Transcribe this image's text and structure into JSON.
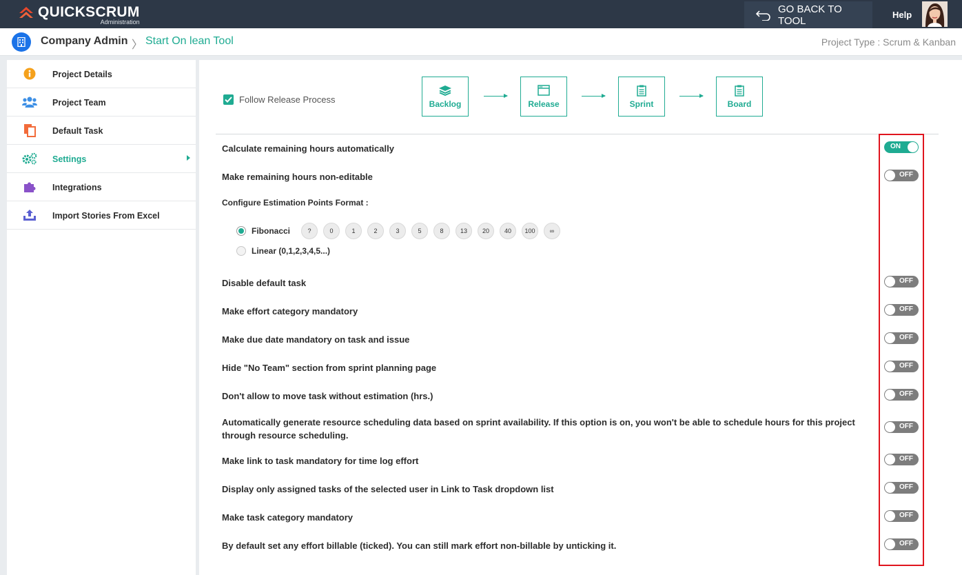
{
  "app": {
    "name": "Quickscrum",
    "subtitle": "Administration"
  },
  "topbar": {
    "go_back_label": "GO BACK TO TOOL",
    "help_label": "Help"
  },
  "breadcrumb": {
    "root": "Company Admin",
    "separator": "〉",
    "current": "Start On lean Tool"
  },
  "project_type": "Project Type : Scrum & Kanban",
  "sidebar": {
    "items": [
      {
        "label": "Project Details",
        "icon": "info-icon",
        "color": "#f5a11c"
      },
      {
        "label": "Project Team",
        "icon": "users-icon",
        "color": "#3d8fe5"
      },
      {
        "label": "Default Task",
        "icon": "copy-icon",
        "color": "#f26b3a"
      },
      {
        "label": "Settings",
        "icon": "gears-icon",
        "color": "#1fab92"
      },
      {
        "label": "Integrations",
        "icon": "puzzle-icon",
        "color": "#8a52c9"
      },
      {
        "label": "Import Stories From Excel",
        "icon": "upload-icon",
        "color": "#5a5fd1"
      }
    ]
  },
  "process": {
    "follow_label": "Follow Release Process",
    "follow_checked": true,
    "steps": [
      "Backlog",
      "Release",
      "Sprint",
      "Board"
    ]
  },
  "toggle_labels": {
    "on": "ON",
    "off": "OFF"
  },
  "settings": [
    {
      "label": "Calculate remaining hours automatically",
      "on": true
    },
    {
      "label": "Make remaining hours non-editable",
      "on": false
    },
    {
      "label": "Disable default task",
      "on": false
    },
    {
      "label": "Make effort category mandatory",
      "on": false
    },
    {
      "label": "Make due date mandatory on task and issue",
      "on": false
    },
    {
      "label": "Hide \"No Team\" section from sprint planning page",
      "on": false
    },
    {
      "label": "Don't allow to move task without estimation (hrs.)",
      "on": false
    },
    {
      "label": "Automatically generate resource scheduling data based on sprint availability. If this option is on, you won't be able to schedule hours for this project through resource scheduling.",
      "on": false
    },
    {
      "label": "Make link to task mandatory for time log effort",
      "on": false
    },
    {
      "label": "Display only assigned tasks of the selected user in Link to Task dropdown list",
      "on": false
    },
    {
      "label": "Make task category mandatory",
      "on": false
    },
    {
      "label": "By default set any effort billable (ticked). You can still mark effort non-billable by unticking it.",
      "on": false
    }
  ],
  "estimation": {
    "title": "Configure Estimation Points Format :",
    "fibonacci_label": "Fibonacci",
    "linear_label": "Linear (0,1,2,3,4,5...)",
    "selected": "Fibonacci",
    "fibonacci_values": [
      "?",
      "0",
      "1",
      "2",
      "3",
      "5",
      "8",
      "13",
      "20",
      "40",
      "100",
      "∞"
    ]
  },
  "colors": {
    "accent": "#1fab92",
    "topbar": "#2d3847",
    "highlight": "#e0141e"
  }
}
